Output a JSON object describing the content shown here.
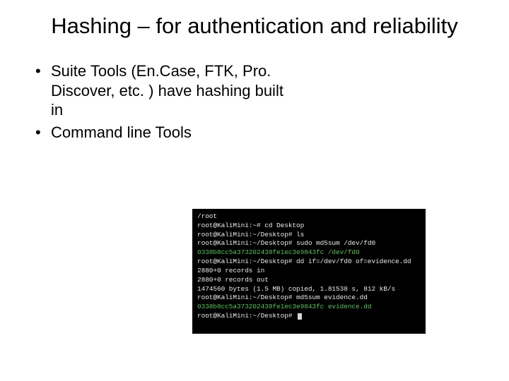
{
  "slide": {
    "title": "Hashing – for authentication and reliability",
    "bullets": [
      "Suite Tools (En.Case, FTK, Pro. Discover, etc. ) have hashing built in",
      "Command line Tools"
    ]
  },
  "terminal": {
    "lines": [
      {
        "text": "/root",
        "cls": "term-white"
      },
      {
        "text": "root@KaliMini:~# cd Desktop",
        "cls": "term-white"
      },
      {
        "text": "root@KaliMini:~/Desktop# ls",
        "cls": "term-white"
      },
      {
        "text": "root@KaliMini:~/Desktop# sudo md5sum /dev/fd0",
        "cls": "term-white"
      },
      {
        "text": "0338b8cc5a373202438fe1ec3e9843fc  /dev/fd0",
        "cls": "term-green"
      },
      {
        "text": "root@KaliMini:~/Desktop# dd if=/dev/fd0 of=evidence.dd",
        "cls": "term-white"
      },
      {
        "text": "2880+0 records in",
        "cls": "term-white"
      },
      {
        "text": "2880+0 records out",
        "cls": "term-white"
      },
      {
        "text": "1474560 bytes (1.5 MB) copied, 1.81538 s, 812 kB/s",
        "cls": "term-white"
      },
      {
        "text": "root@KaliMini:~/Desktop# md5sum evidence.dd",
        "cls": "term-white"
      },
      {
        "text": "0338b8cc5a373202438fe1ec3e9843fc  evidence.dd",
        "cls": "term-green"
      },
      {
        "text": "root@KaliMini:~/Desktop# ",
        "cls": "term-white",
        "cursor": true
      }
    ]
  }
}
